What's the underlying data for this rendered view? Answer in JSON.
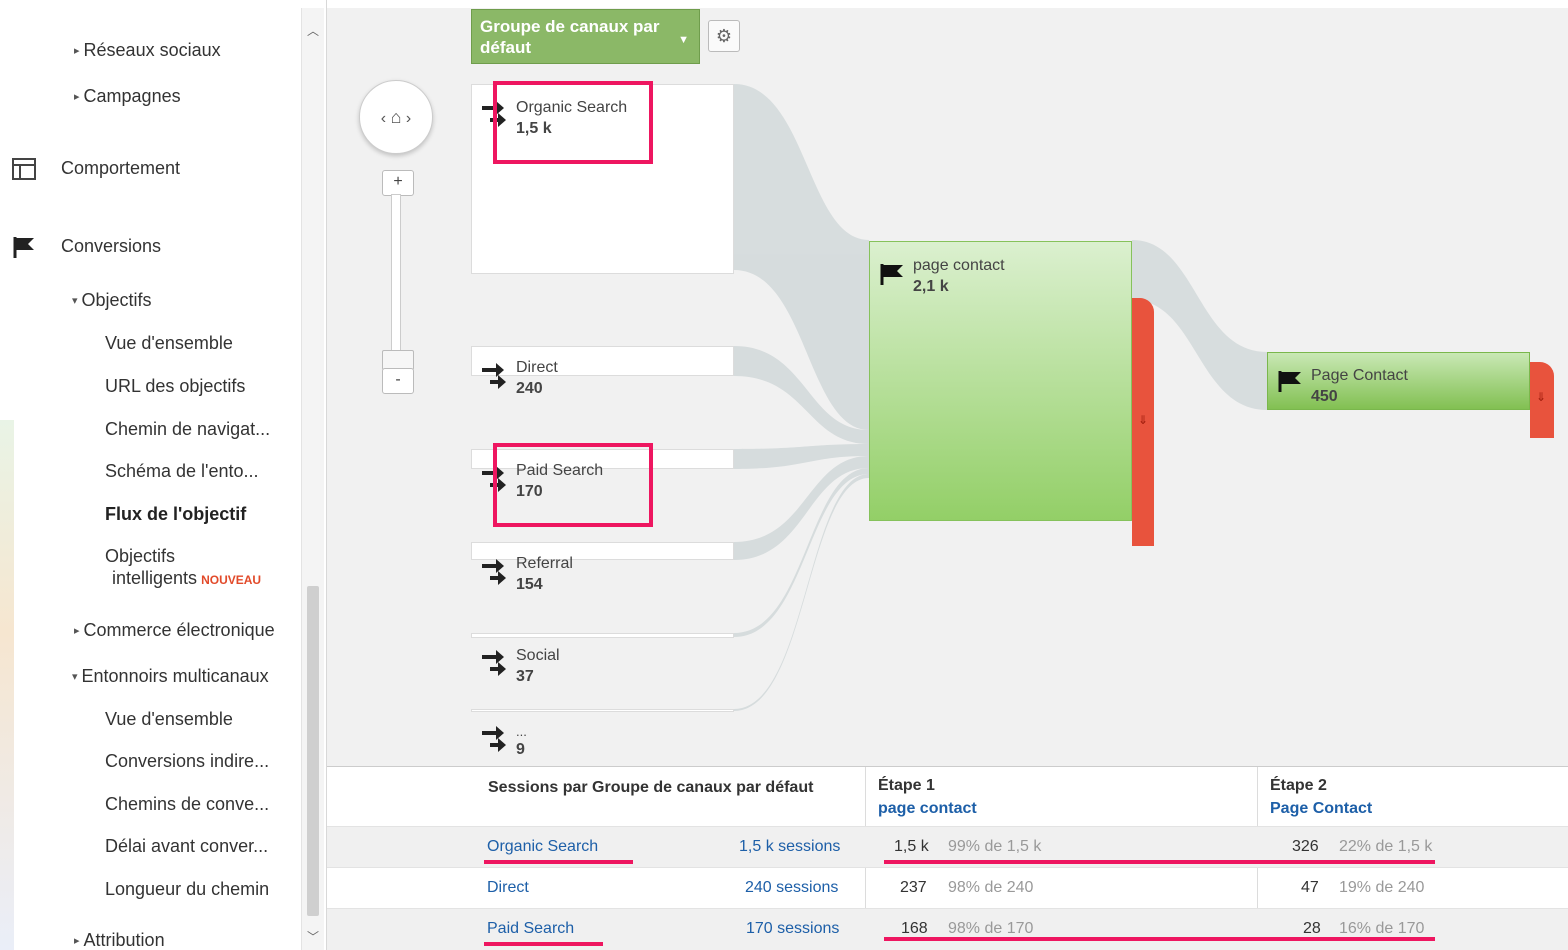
{
  "sidebar": {
    "items": [
      {
        "label": "Réseaux sociaux",
        "expander": "▸"
      },
      {
        "label": "Campagnes",
        "expander": "▸"
      },
      {
        "label": "Comportement"
      },
      {
        "label": "Conversions"
      },
      {
        "label": "Objectifs",
        "expander": "▾"
      },
      {
        "label": "Vue d'ensemble"
      },
      {
        "label": "URL des objectifs"
      },
      {
        "label": "Chemin de navigat..."
      },
      {
        "label": "Schéma de l'ento..."
      },
      {
        "label": "Flux de l'objectif"
      },
      {
        "label": "Objectifs"
      },
      {
        "label": "intelligents",
        "badge": "NOUVEAU"
      },
      {
        "label": "Commerce électronique",
        "expander": "▸"
      },
      {
        "label": "Entonnoirs multicanaux",
        "expander": "▾"
      },
      {
        "label": "Vue d'ensemble"
      },
      {
        "label": "Conversions indire..."
      },
      {
        "label": "Chemins de conve..."
      },
      {
        "label": "Délai avant conver..."
      },
      {
        "label": "Longueur du chemin"
      },
      {
        "label": "Attribution",
        "expander": "▸"
      }
    ]
  },
  "flow": {
    "dimension_button": {
      "line1": "Groupe de canaux par",
      "line2": "défaut"
    },
    "sources": [
      {
        "label": "Organic Search",
        "value": "1,5 k"
      },
      {
        "label": "Direct",
        "value": "240"
      },
      {
        "label": "Paid Search",
        "value": "170"
      },
      {
        "label": "Referral",
        "value": "154"
      },
      {
        "label": "Social",
        "value": "37"
      },
      {
        "label": "...",
        "value": "9"
      }
    ],
    "step1": {
      "label": "page contact",
      "value": "2,1 k"
    },
    "step2": {
      "label": "Page Contact",
      "value": "450"
    }
  },
  "table": {
    "col1_header": "Sessions par Groupe de canaux par défaut",
    "col2_header": "Étape 1",
    "col2_sub": "page contact",
    "col3_header": "Étape 2",
    "col3_sub": "Page Contact",
    "rows": [
      {
        "channel": "Organic Search",
        "sessions": "1,5 k sessions",
        "s1": "1,5 k",
        "s1pct": "99% de 1,5 k",
        "s2": "326",
        "s2pct": "22% de 1,5 k"
      },
      {
        "channel": "Direct",
        "sessions": "240 sessions",
        "s1": "237",
        "s1pct": "98% de 240",
        "s2": "47",
        "s2pct": "19% de 240"
      },
      {
        "channel": "Paid Search",
        "sessions": "170 sessions",
        "s1": "168",
        "s1pct": "98% de 170",
        "s2": "28",
        "s2pct": "16% de 170"
      }
    ]
  },
  "colors": {
    "accent_highlight": "#ee1660",
    "node_green": "#93cf67",
    "drop_red": "#e8533d",
    "link_blue": "#1d5fa8"
  }
}
